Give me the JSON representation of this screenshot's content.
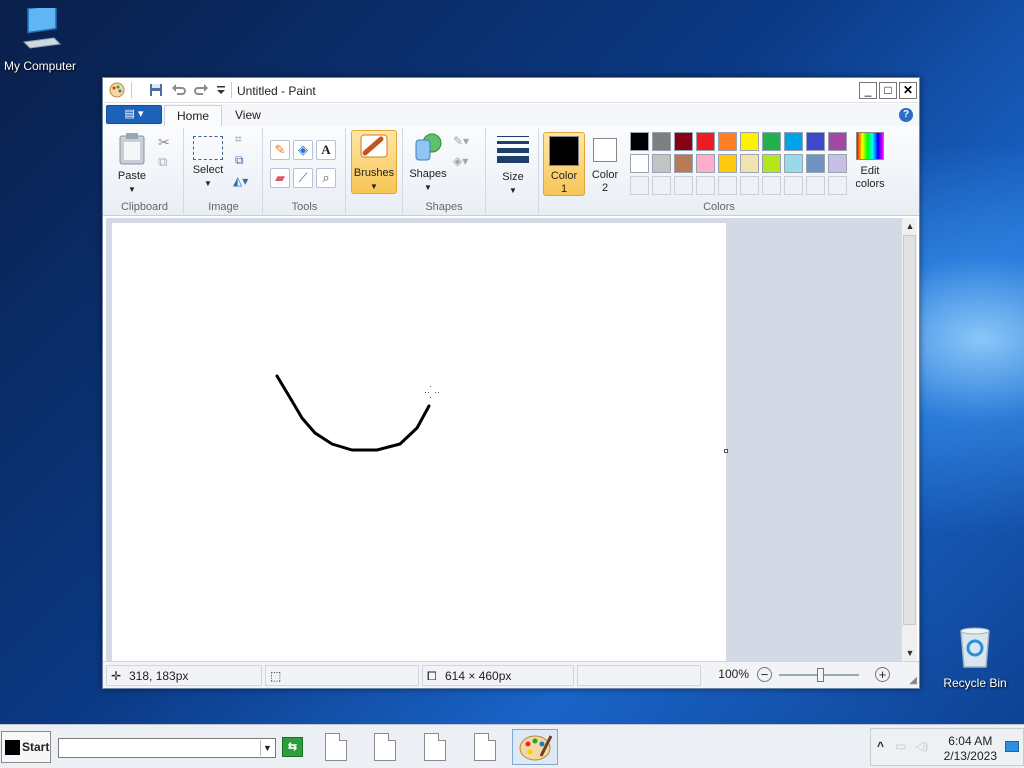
{
  "desktop": {
    "icons": [
      {
        "label": "My Computer",
        "icon": "computer-icon"
      },
      {
        "label": "Recycle Bin",
        "icon": "recycle-bin-icon"
      }
    ]
  },
  "window": {
    "title": "Untitled - Paint",
    "controls": {
      "minimize": "_",
      "maximize": "□",
      "close": "✕"
    },
    "file_menu": "▤ ▾",
    "help": "?"
  },
  "tabs": [
    "Home",
    "View"
  ],
  "ribbon": {
    "clipboard": {
      "group": "Clipboard",
      "paste": "Paste"
    },
    "image": {
      "group": "Image",
      "select": "Select"
    },
    "tools": {
      "group": "Tools",
      "text_tool": "A"
    },
    "brushes": {
      "label": "Brushes"
    },
    "shapes": {
      "group": "Shapes",
      "label": "Shapes"
    },
    "size": {
      "label": "Size"
    },
    "colors": {
      "group": "Colors",
      "color1_label": "Color 1",
      "color2_label": "Color 2",
      "edit_colors": "Edit colors",
      "color1": "#000000",
      "color2": "#ffffff",
      "palette_row1": [
        "#000000",
        "#7f7f7f",
        "#880015",
        "#ed1c24",
        "#ff7f27",
        "#fff200",
        "#22b14c",
        "#00a2e8",
        "#3f48cc",
        "#a349a4"
      ],
      "palette_row2": [
        "#ffffff",
        "#c3c3c3",
        "#b97a57",
        "#ffaec9",
        "#ffc90e",
        "#efe4b0",
        "#b5e61d",
        "#99d9ea",
        "#7092be",
        "#c8bfe7"
      ]
    }
  },
  "statusbar": {
    "cursor_pos": "318, 183px",
    "selection_size": "",
    "canvas_size": "614 × 460px",
    "zoom": "100%"
  },
  "taskbar": {
    "start": "Start",
    "address_value": "",
    "go": "⇆",
    "clock_time": "6:04 AM",
    "clock_date": "2/13/2023",
    "tray_chevron": "^"
  }
}
